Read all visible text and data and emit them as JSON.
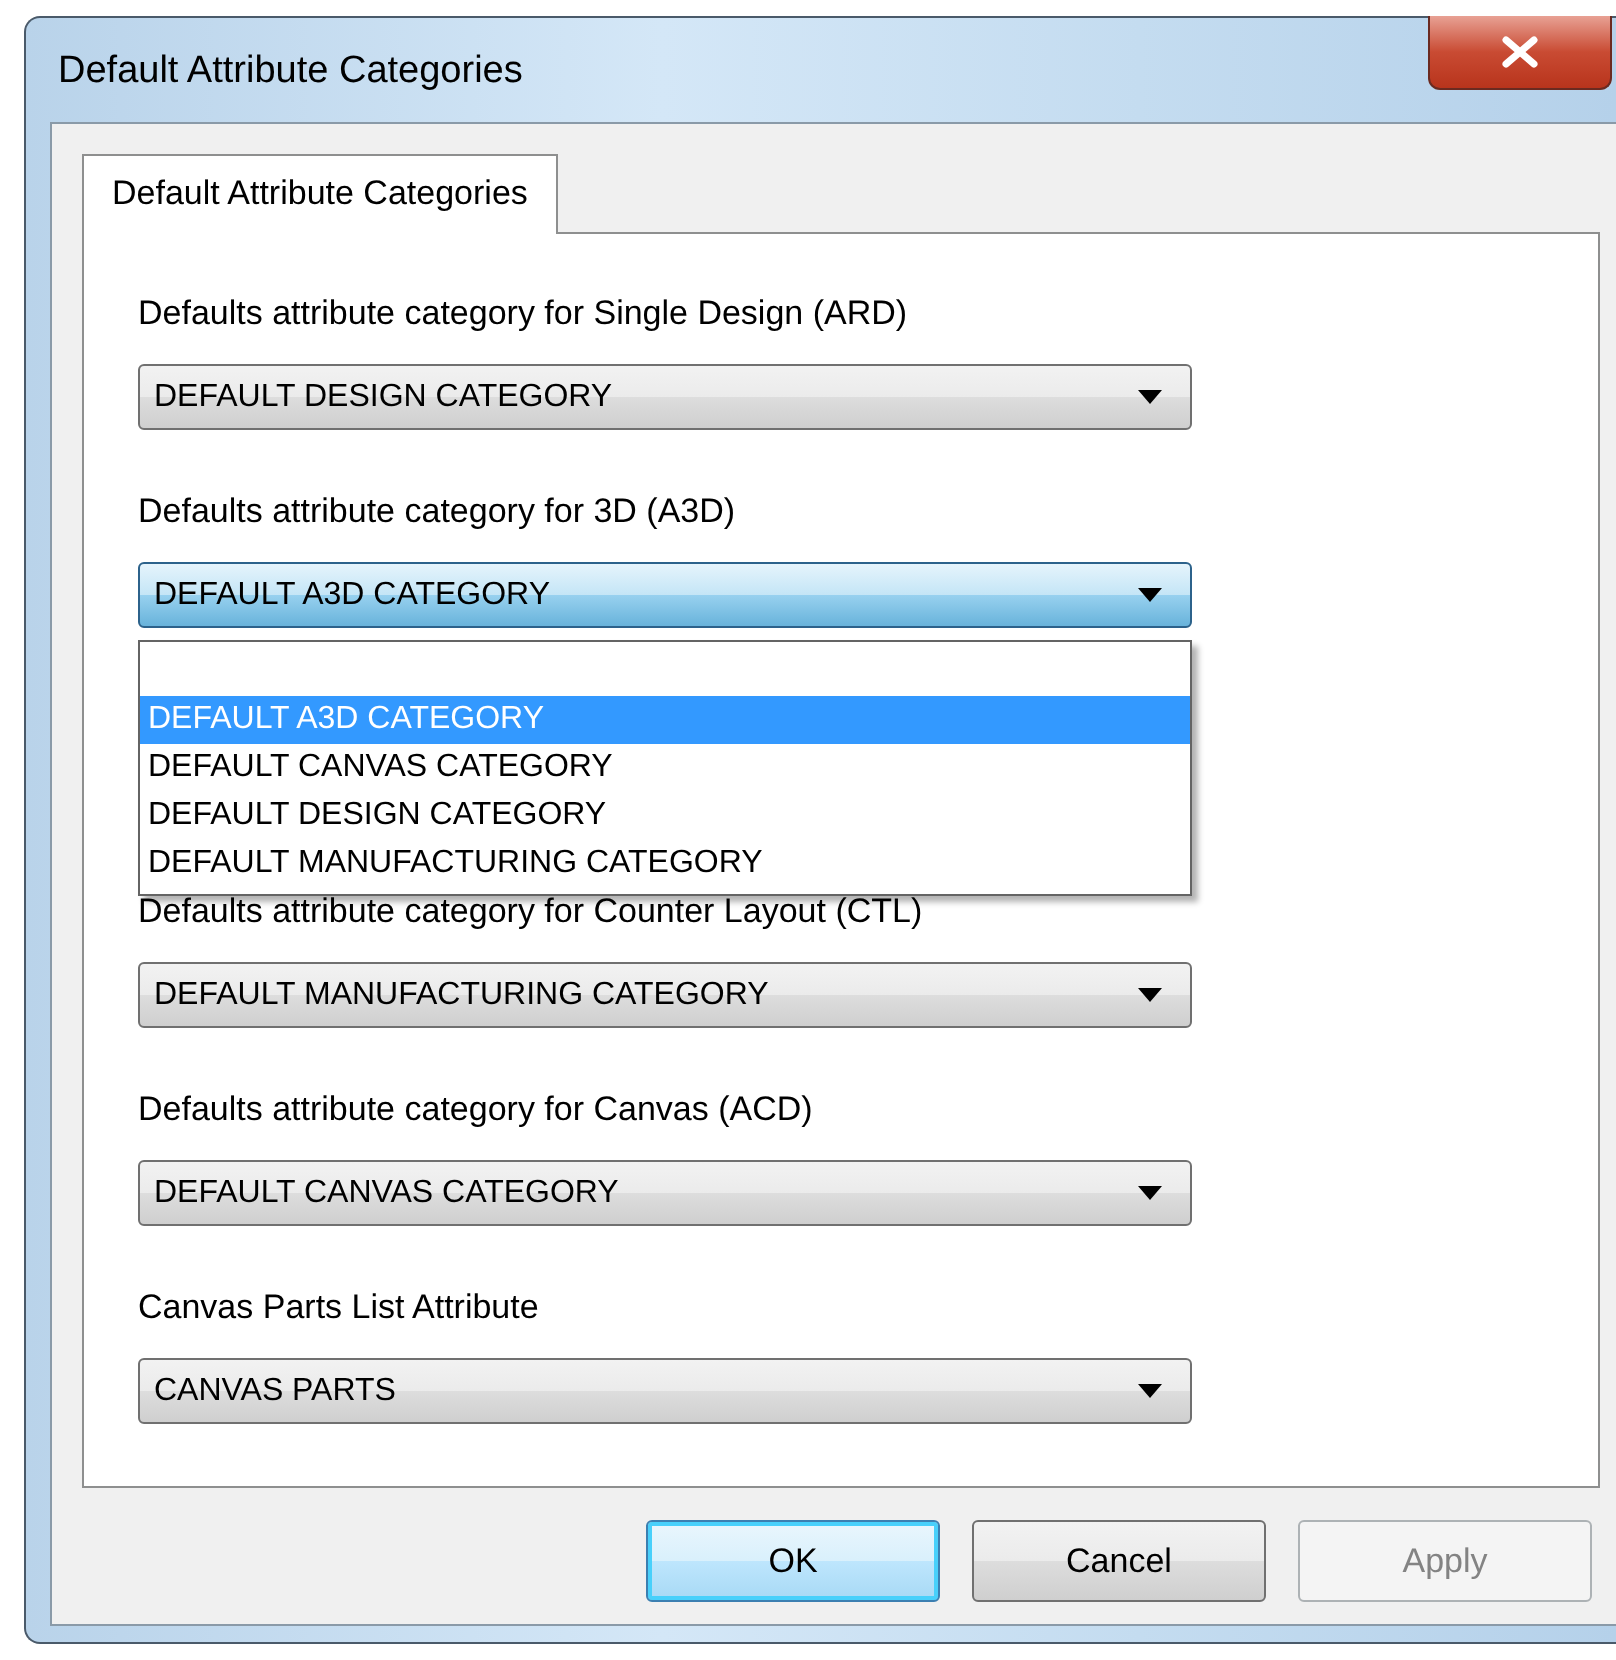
{
  "window": {
    "title": "Default Attribute Categories"
  },
  "tabs": [
    {
      "label": "Default Attribute Categories",
      "selected": true
    }
  ],
  "fields": [
    {
      "label": "Defaults attribute category for Single Design (ARD)",
      "value": "DEFAULT DESIGN CATEGORY",
      "open": false
    },
    {
      "label": "Defaults attribute category for 3D (A3D)",
      "value": "DEFAULT A3D CATEGORY",
      "open": true,
      "options": [
        {
          "label": "DEFAULT A3D CATEGORY",
          "selected": true
        },
        {
          "label": "DEFAULT CANVAS CATEGORY",
          "selected": false
        },
        {
          "label": "DEFAULT DESIGN CATEGORY",
          "selected": false
        },
        {
          "label": "DEFAULT MANUFACTURING CATEGORY",
          "selected": false
        }
      ]
    },
    {
      "label": "Defaults attribute category for Counter Layout (CTL)",
      "value": "DEFAULT MANUFACTURING CATEGORY",
      "open": false
    },
    {
      "label": "Defaults attribute category for Canvas (ACD)",
      "value": "DEFAULT CANVAS CATEGORY",
      "open": false
    },
    {
      "label": "Canvas Parts List Attribute",
      "value": "CANVAS PARTS",
      "open": false
    }
  ],
  "buttons": [
    {
      "label": "OK",
      "default": true,
      "disabled": false
    },
    {
      "label": "Cancel",
      "default": false,
      "disabled": false
    },
    {
      "label": "Apply",
      "default": false,
      "disabled": true
    }
  ]
}
